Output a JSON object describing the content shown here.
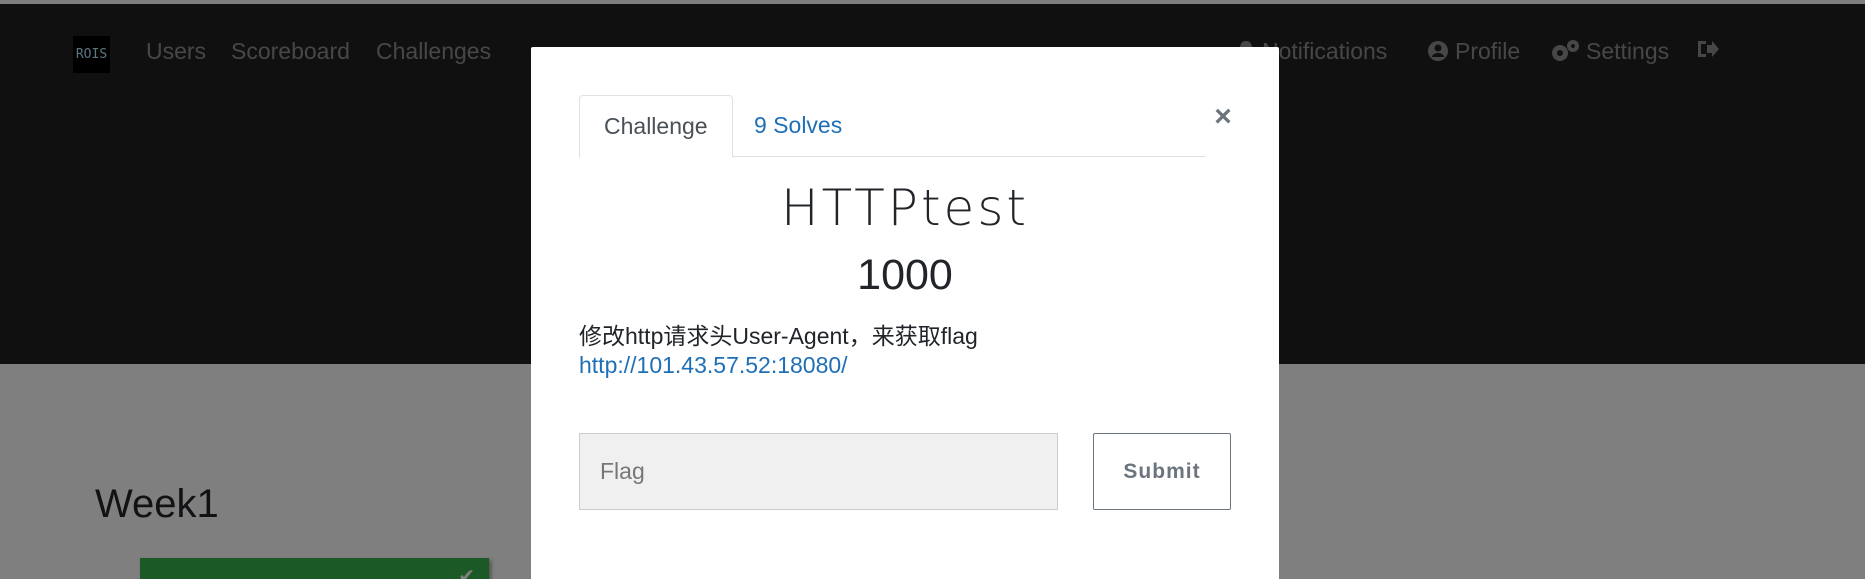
{
  "navbar": {
    "logo_text": "ROIS",
    "links": [
      "Users",
      "Scoreboard",
      "Challenges"
    ],
    "right": {
      "notifications": "Notifications",
      "profile": "Profile",
      "settings": "Settings"
    }
  },
  "main": {
    "category_title": "Week1"
  },
  "modal": {
    "tabs": {
      "challenge": "Challenge",
      "solves": "9 Solves"
    },
    "close_symbol": "×",
    "challenge_name": "HTTPtest",
    "points": "1000",
    "description": "修改http请求头User-Agent，来获取flag",
    "link": "http://101.43.57.52:18080/",
    "flag_placeholder": "Flag",
    "submit_label": "Submit"
  },
  "colors": {
    "navbar_bg": "#212121",
    "link_blue": "#1f6fb7",
    "solved_card": "#37b24d"
  }
}
